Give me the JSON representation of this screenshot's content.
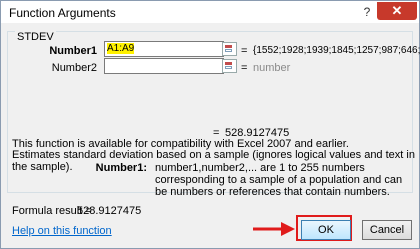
{
  "window": {
    "title": "Function Arguments",
    "help_symbol": "?",
    "close_symbol": "✕"
  },
  "function_name": "STDEV",
  "args": [
    {
      "label": "Number1",
      "value": "A1:A9",
      "equals": "=",
      "result": "{1552;1928;1939;1845;1257;987;646;20"
    },
    {
      "label": "Number2",
      "value": "",
      "equals": "=",
      "result": "number"
    }
  ],
  "result": {
    "equals": "=",
    "value": "528.9127475"
  },
  "description": {
    "line1": "This function is available for compatibility with Excel 2007 and earlier.",
    "line2": "Estimates standard deviation based on a sample (ignores logical values and text in the sample)."
  },
  "arg_description": {
    "name": "Number1:",
    "text": "number1,number2,... are 1 to 255 numbers corresponding to a sample of a population and can be numbers or references that contain numbers."
  },
  "formula": {
    "label": "Formula result =",
    "value": "528.9127475"
  },
  "help_link": "Help on this function",
  "buttons": {
    "ok": "OK",
    "cancel": "Cancel"
  },
  "colors": {
    "highlight": "#fff200",
    "annotation_red": "#e01b1b",
    "close_red": "#c7392b"
  }
}
